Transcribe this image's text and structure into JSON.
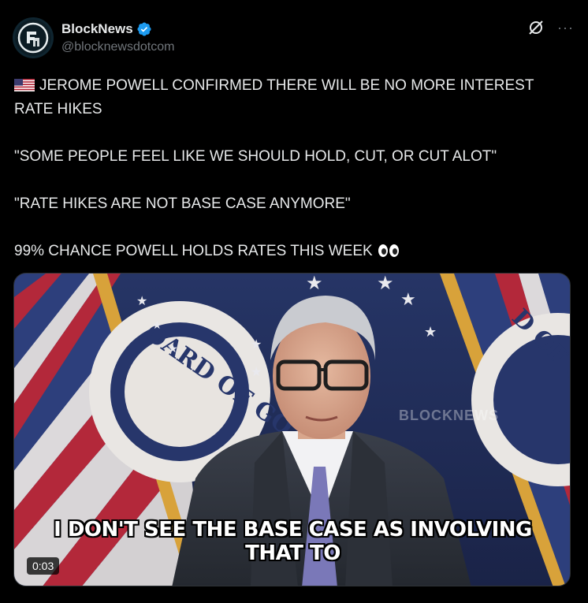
{
  "author": {
    "display_name": "BlockNews",
    "handle": "@blocknewsdotcom",
    "verified": true,
    "verified_color": "#1d9bf0"
  },
  "actions": {
    "grok_icon": "grok-slash-icon",
    "more_label": "···"
  },
  "post": {
    "line1": "JEROME POWELL CONFIRMED THERE WILL BE NO MORE INTEREST RATE HIKES",
    "line1_flag": "us-flag-emoji",
    "line2": "\"SOME PEOPLE FEEL LIKE WE SHOULD HOLD, CUT, OR CUT ALOT\"",
    "line3": "\"RATE HIKES ARE NOT BASE CASE ANYMORE\"",
    "line4": "99% CHANCE POWELL HOLDS RATES THIS WEEK",
    "line4_emoji": "eyes-emoji"
  },
  "media": {
    "subtitle_line1": "I DON'T SEE THE BASE CASE AS INVOLVING",
    "subtitle_line2": "THAT TO",
    "timestamp": "0:03",
    "watermark": "BLOCKNEWS",
    "seal_text_left": "OARD OF GO",
    "seal_text_right": "D OF GOVER"
  },
  "colors": {
    "background": "#000000",
    "text": "#e7e9ea",
    "muted": "#71767b"
  }
}
